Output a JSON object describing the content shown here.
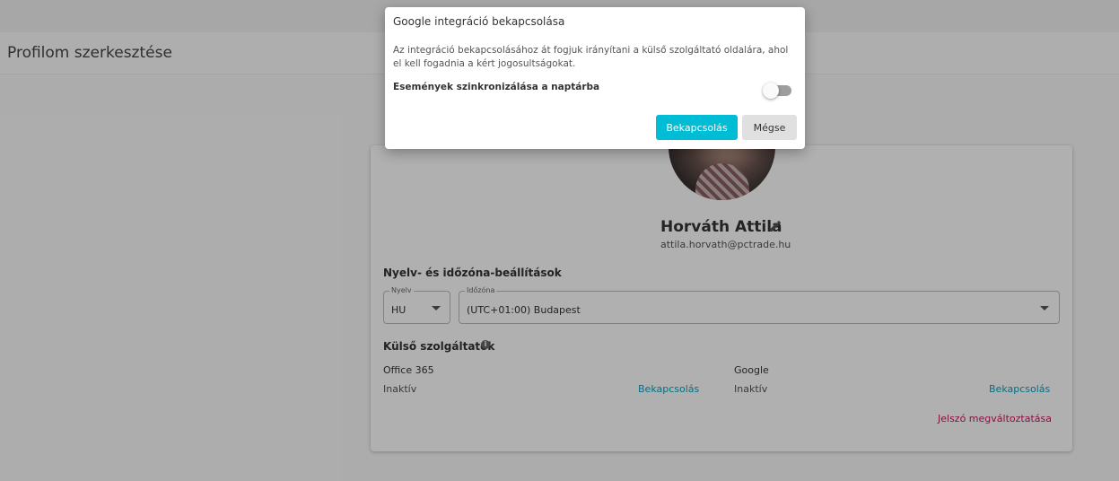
{
  "page": {
    "title": "Profilom szerkesztése"
  },
  "profile": {
    "name": "Horváth Attila",
    "email": "attila.horvath@pctrade.hu"
  },
  "settings": {
    "section_title": "Nyelv- és időzóna-beállítások",
    "language": {
      "label": "Nyelv",
      "value": "HU"
    },
    "timezone": {
      "label": "Időzóna",
      "value": "(UTC+01:00) Budapest"
    }
  },
  "services": {
    "section_title": "Külső szolgáltatók",
    "items": [
      {
        "name": "Office 365",
        "status": "Inaktív",
        "action": "Bekapcsolás"
      },
      {
        "name": "Google",
        "status": "Inaktív",
        "action": "Bekapcsolás"
      }
    ],
    "change_password": "Jelszó megváltoztatása"
  },
  "dialog": {
    "title": "Google integráció bekapcsolása",
    "text": "Az integráció bekapcsolásához át fogjuk irányítani a külső szolgáltató oldalára, ahol el kell fogadnia a kért jogosultságokat.",
    "toggle_label": "Események szinkronizálása a naptárba",
    "toggle_on": false,
    "confirm": "Bekapcsolás",
    "cancel": "Mégse"
  },
  "colors": {
    "accent": "#00bcd4",
    "link": "#00a5c4",
    "danger_link": "#c2185b"
  },
  "icons": {
    "edit": "pencil-icon",
    "info": "info-icon",
    "dropdown": "chevron-down-icon"
  }
}
